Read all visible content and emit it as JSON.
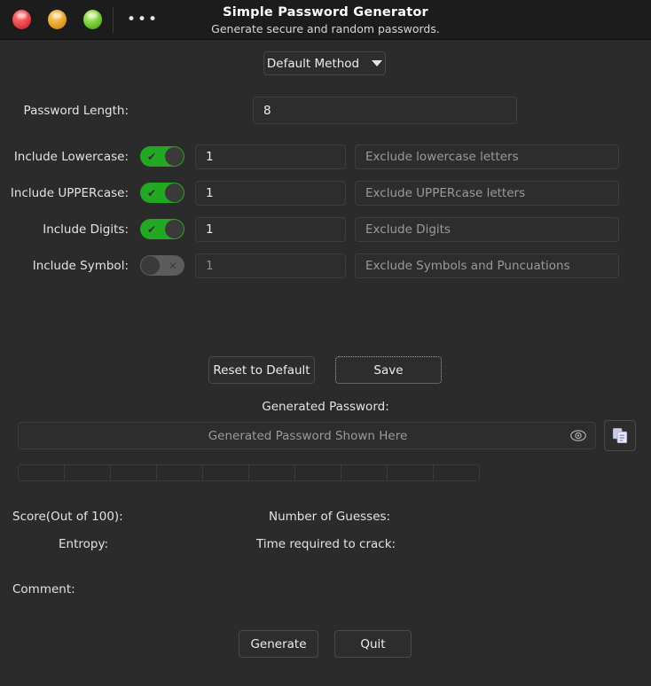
{
  "window": {
    "title": "Simple Password Generator",
    "subtitle": "Generate secure and random passwords.",
    "menu_dots": "•••",
    "traffic_lights": [
      {
        "name": "close",
        "color": "#e8434a"
      },
      {
        "name": "minimize",
        "color": "#e8a22a"
      },
      {
        "name": "maximize",
        "color": "#74c832"
      }
    ]
  },
  "method": {
    "selected": "Default Method",
    "icon": "chevron-down-icon"
  },
  "length": {
    "label": "Password Length:",
    "value": "8"
  },
  "options": [
    {
      "label": "Include Lowercase:",
      "enabled": true,
      "toggle_glyph": "✔",
      "count": "1",
      "exclude_placeholder": "Exclude lowercase letters",
      "exclude_value": ""
    },
    {
      "label": "Include UPPERcase:",
      "enabled": true,
      "toggle_glyph": "✔",
      "count": "1",
      "exclude_placeholder": "Exclude UPPERcase letters",
      "exclude_value": ""
    },
    {
      "label": "Include Digits:",
      "enabled": true,
      "toggle_glyph": "✔",
      "count": "1",
      "exclude_placeholder": "Exclude Digits",
      "exclude_value": ""
    },
    {
      "label": "Include Symbol:",
      "enabled": false,
      "toggle_glyph": "✕",
      "count": "1",
      "exclude_placeholder": "Exclude Symbols and Puncuations",
      "exclude_value": ""
    }
  ],
  "actions": {
    "reset": "Reset to Default",
    "save": "Save",
    "generate": "Generate",
    "quit": "Quit"
  },
  "password": {
    "section_label": "Generated Password:",
    "placeholder": "Generated Password Shown Here",
    "value": "",
    "reveal_icon": "eye-icon",
    "copy_icon": "copy-icon",
    "meter_segments": 10,
    "meter_filled": 0
  },
  "stats": {
    "score_label": "Score(Out of 100):",
    "score_value": "",
    "guesses_label": "Number of Guesses:",
    "guesses_value": "",
    "entropy_label": "Entropy:",
    "entropy_value": "",
    "crack_label": "Time required to crack:",
    "crack_value": "",
    "comment_label": "Comment:",
    "comment_value": ""
  },
  "colors": {
    "background": "#2b2b2b",
    "titlebar": "#1c1c1c",
    "toggle_on": "#22a822",
    "toggle_off": "#5c5c5c",
    "field": "#2d2d2d"
  }
}
